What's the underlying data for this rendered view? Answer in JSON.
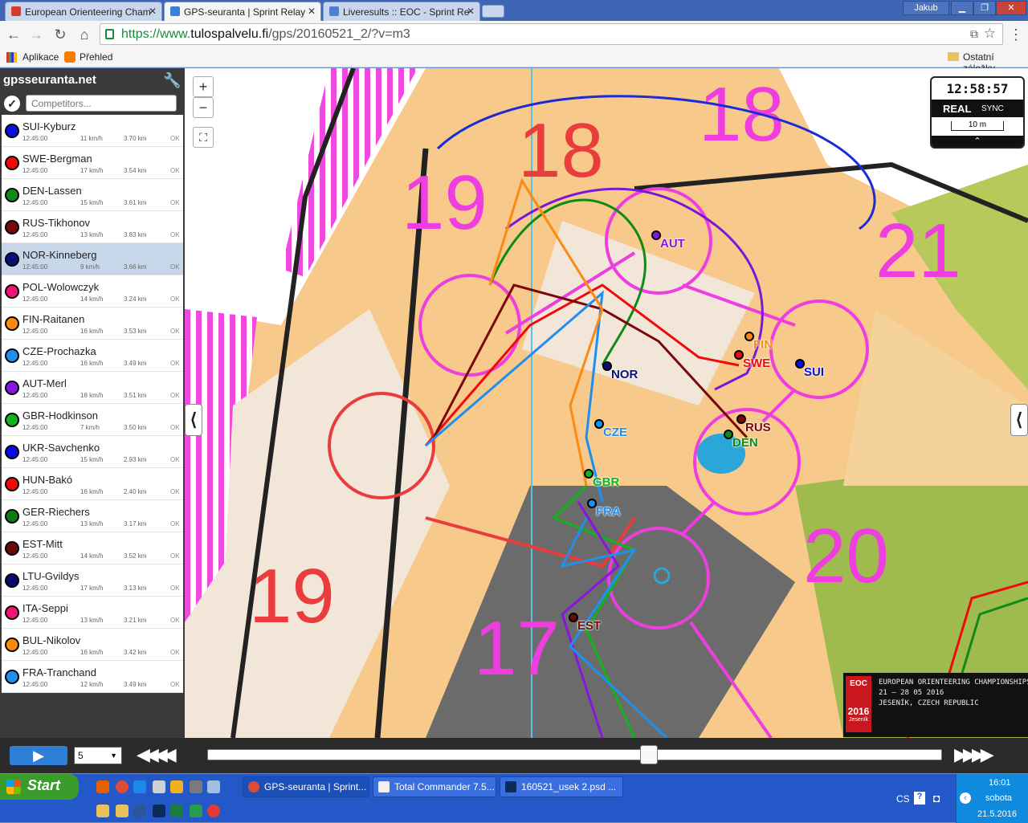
{
  "tabs": [
    {
      "title": "European Orienteering Cham",
      "fav_color": "#d63a2b"
    },
    {
      "title": "GPS-seuranta | Sprint Relay",
      "fav_color": "#3a7fd6"
    },
    {
      "title": "Liveresults :: EOC - Sprint Re",
      "fav_color": "#4d7fd0"
    }
  ],
  "window": {
    "user": "Jakub"
  },
  "address": {
    "prefix": "https://www.",
    "host": "tulospalvelu.fi",
    "path": "/gps/20160521_2/?v=m3"
  },
  "bookmarks": {
    "apps": "Aplikace",
    "overview": "Přehled",
    "other": "Ostatní záložky"
  },
  "panel": {
    "brand": "gpsseuranta.net",
    "search_placeholder": "Competitors..."
  },
  "competitors": [
    {
      "name": "SUI-Kyburz",
      "time": "12:45:00",
      "speed": "11 km/h",
      "dist": "3.70 km",
      "status": "OK",
      "color": "#0a12e0"
    },
    {
      "name": "SWE-Bergman",
      "time": "12:45:00",
      "speed": "17 km/h",
      "dist": "3.54 km",
      "status": "OK",
      "color": "#f00a0a"
    },
    {
      "name": "DEN-Lassen",
      "time": "12:45:00",
      "speed": "15 km/h",
      "dist": "3.61 km",
      "status": "OK",
      "color": "#0f8a16"
    },
    {
      "name": "RUS-Tikhonov",
      "time": "12:45:00",
      "speed": "13 km/h",
      "dist": "3.83 km",
      "status": "OK",
      "color": "#7a0808"
    },
    {
      "name": "NOR-Kinneberg",
      "time": "12:45:00",
      "speed": "9 km/h",
      "dist": "3.66 km",
      "status": "OK",
      "color": "#0a0f7a",
      "selected": true
    },
    {
      "name": "POL-Wolowczyk",
      "time": "12:45:00",
      "speed": "14 km/h",
      "dist": "3.24 km",
      "status": "OK",
      "color": "#f0147a"
    },
    {
      "name": "FIN-Raitanen",
      "time": "12:45:00",
      "speed": "16 km/h",
      "dist": "3.53 km",
      "status": "OK",
      "color": "#fa8a12"
    },
    {
      "name": "CZE-Prochazka",
      "time": "12:45:00",
      "speed": "16 km/h",
      "dist": "3.49 km",
      "status": "OK",
      "color": "#1e8ef0"
    },
    {
      "name": "AUT-Merl",
      "time": "12:45:00",
      "speed": "18 km/h",
      "dist": "3.51 km",
      "status": "OK",
      "color": "#8a14e0"
    },
    {
      "name": "GBR-Hodkinson",
      "time": "12:45:00",
      "speed": "7 km/h",
      "dist": "3.50 km",
      "status": "OK",
      "color": "#12b41e"
    },
    {
      "name": "UKR-Savchenko",
      "time": "12:45:00",
      "speed": "15 km/h",
      "dist": "2.93 km",
      "status": "OK",
      "color": "#0a0ae6"
    },
    {
      "name": "HUN-Bakó",
      "time": "12:45:00",
      "speed": "16 km/h",
      "dist": "2.40 km",
      "status": "OK",
      "color": "#f00a0a"
    },
    {
      "name": "GER-Riechers",
      "time": "12:45:00",
      "speed": "13 km/h",
      "dist": "3.17 km",
      "status": "OK",
      "color": "#0f7a14"
    },
    {
      "name": "EST-Mitt",
      "time": "12:45:00",
      "speed": "14 km/h",
      "dist": "3.52 km",
      "status": "OK",
      "color": "#6a0a0a"
    },
    {
      "name": "LTU-Gvildys",
      "time": "12:45:00",
      "speed": "17 km/h",
      "dist": "3.13 km",
      "status": "OK",
      "color": "#0a0a6e"
    },
    {
      "name": "ITA-Seppi",
      "time": "12:45:00",
      "speed": "13 km/h",
      "dist": "3.21 km",
      "status": "OK",
      "color": "#f01478"
    },
    {
      "name": "BUL-Nikolov",
      "time": "12:45:00",
      "speed": "16 km/h",
      "dist": "3.42 km",
      "status": "OK",
      "color": "#fa8a0a"
    },
    {
      "name": "FRA-Tranchand",
      "time": "12:45:00",
      "speed": "12 km/h",
      "dist": "3.49 km",
      "status": "OK",
      "color": "#1e90f0"
    }
  ],
  "map": {
    "zoom_in": "+",
    "zoom_out": "−",
    "control_numbers": [
      "18",
      "18",
      "19",
      "21",
      "19",
      "20",
      "17"
    ],
    "runner_labels": [
      "AUT",
      "FIN",
      "SWE",
      "SUI",
      "NOR",
      "RUS",
      "CZE",
      "DEN",
      "GBR",
      "FRA",
      "EST"
    ]
  },
  "clock": {
    "time": "12:58:57",
    "mode": "REAL",
    "sync": "SYNC",
    "scale": "10 m"
  },
  "banner": {
    "logo_top": "EOC",
    "logo_year": "2016",
    "logo_place": "Jeseník",
    "line1": "EUROPEAN ORIENTEERING CHAMPIONSHIPS",
    "line2": "21 – 28 05 2016",
    "line3": "JESENÍK, CZECH REPUBLIC"
  },
  "playback": {
    "speed_value": "5"
  },
  "taskbar": {
    "start": "Start",
    "items": [
      "GPS-seuranta | Sprint...",
      "Total Commander 7.5...",
      "160521_usek 2.psd ..."
    ],
    "lang": "CS",
    "clock_time": "16:01",
    "clock_day": "sobota",
    "clock_date": "21.5.2016"
  }
}
